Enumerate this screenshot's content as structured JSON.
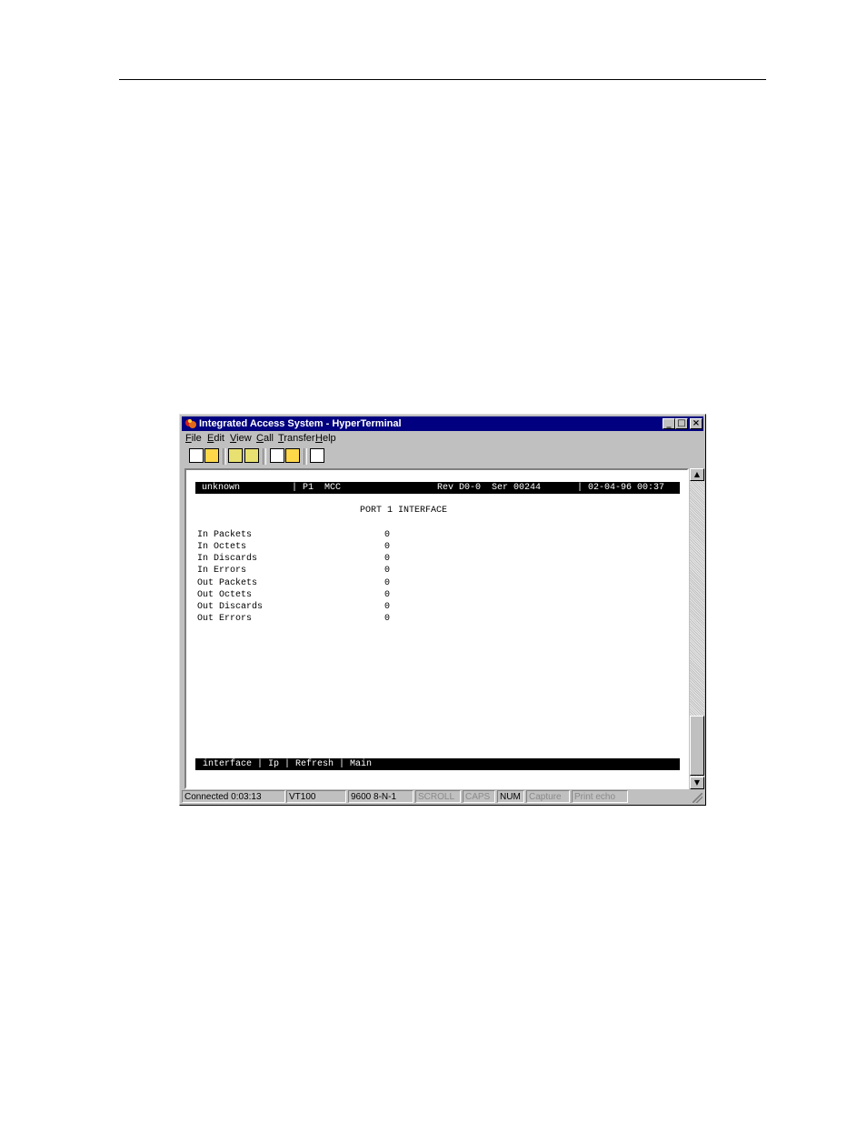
{
  "window": {
    "title": "Integrated Access System - HyperTerminal",
    "controls": {
      "minimize": "_",
      "maximize": "□",
      "close": "×"
    }
  },
  "menubar": {
    "items": [
      {
        "accel": "F",
        "rest": "ile"
      },
      {
        "accel": "E",
        "rest": "dit"
      },
      {
        "accel": "V",
        "rest": "iew"
      },
      {
        "accel": "C",
        "rest": "all"
      },
      {
        "accel": "T",
        "rest": "ransfer"
      },
      {
        "accel": "H",
        "rest": "elp"
      }
    ]
  },
  "toolbar": {
    "icons": [
      "new-document-icon",
      "open-folder-icon",
      "connect-phone-icon",
      "disconnect-phone-icon",
      "send-file-icon",
      "receive-file-icon",
      "properties-icon"
    ]
  },
  "terminal": {
    "header": {
      "name": "unknown",
      "port": "| P1  MCC",
      "rev": "Rev D0-0  Ser 00244",
      "datetime": "| 02-04-96 00:37"
    },
    "screen_title": "PORT 1 INTERFACE",
    "rows": [
      {
        "label": "In Packets",
        "value": "0"
      },
      {
        "label": "In Octets",
        "value": "0"
      },
      {
        "label": "In Discards",
        "value": "0"
      },
      {
        "label": "In Errors",
        "value": "0"
      },
      {
        "label": "Out Packets",
        "value": "0"
      },
      {
        "label": "Out Octets",
        "value": "0"
      },
      {
        "label": "Out Discards",
        "value": "0"
      },
      {
        "label": "Out Errors",
        "value": "0"
      }
    ],
    "footer_menu": "interface | Ip | Refresh | Main"
  },
  "scrollbar": {
    "up": "▲",
    "down": "▼"
  },
  "statusbar": {
    "connected": "Connected 0:03:13",
    "emulation": "VT100",
    "settings": "9600 8-N-1",
    "scroll": "SCROLL",
    "caps": "CAPS",
    "num": "NUM",
    "capture": "Capture",
    "print_echo": "Print echo"
  }
}
